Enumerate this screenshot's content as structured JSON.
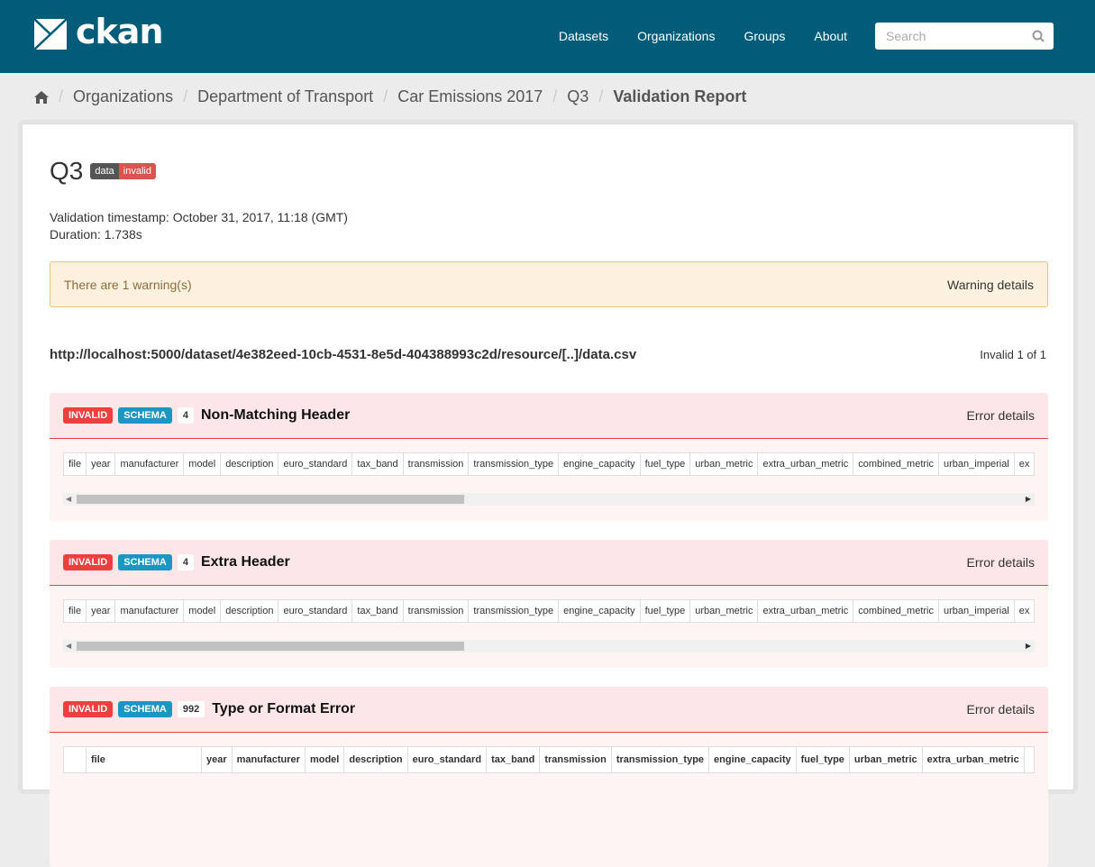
{
  "header": {
    "logo": "ckan",
    "nav": [
      "Datasets",
      "Organizations",
      "Groups",
      "About"
    ],
    "search_placeholder": "Search"
  },
  "breadcrumb": [
    "Organizations",
    "Department of Transport",
    "Car Emissions 2017",
    "Q3"
  ],
  "breadcrumb_current": "Validation Report",
  "resource": {
    "title": "Q3",
    "badge_left": "data",
    "badge_right": "invalid",
    "timestamp": "Validation timestamp: October 31, 2017, 11:18 (GMT)",
    "duration": "Duration: 1.738s"
  },
  "warning": {
    "message": "There are 1 warning(s)",
    "details": "Warning details"
  },
  "report": {
    "url": "http://localhost:5000/dataset/4e382eed-10cb-4531-8e5d-404388993c2d/resource/[..]/data.csv",
    "count": "Invalid 1 of 1"
  },
  "colors": {
    "header": "#005c78",
    "invalid": "#ee3e3e",
    "schema": "#1a97c0",
    "badge_data": "#555555",
    "badge_invalid": "#d9534f"
  },
  "errors": [
    {
      "status": "INVALID",
      "type": "SCHEMA",
      "count": "4",
      "title": "Non-Matching Header",
      "details": "Error details",
      "columns": [
        "file",
        "year",
        "manufacturer",
        "model",
        "description",
        "euro_standard",
        "tax_band",
        "transmission",
        "transmission_type",
        "engine_capacity",
        "fuel_type",
        "urban_metric",
        "extra_urban_metric",
        "combined_metric",
        "urban_imperial",
        "ex"
      ]
    },
    {
      "status": "INVALID",
      "type": "SCHEMA",
      "count": "4",
      "title": "Extra Header",
      "details": "Error details",
      "columns": [
        "file",
        "year",
        "manufacturer",
        "model",
        "description",
        "euro_standard",
        "tax_band",
        "transmission",
        "transmission_type",
        "engine_capacity",
        "fuel_type",
        "urban_metric",
        "extra_urban_metric",
        "combined_metric",
        "urban_imperial",
        "ex"
      ]
    },
    {
      "status": "INVALID",
      "type": "SCHEMA",
      "count": "992",
      "title": "Type or Format Error",
      "details": "Error details",
      "columns": [
        "",
        "file",
        "year",
        "manufacturer",
        "model",
        "description",
        "euro_standard",
        "tax_band",
        "transmission",
        "transmission_type",
        "engine_capacity",
        "fuel_type",
        "urban_metric",
        "extra_urban_metric",
        ""
      ]
    }
  ]
}
